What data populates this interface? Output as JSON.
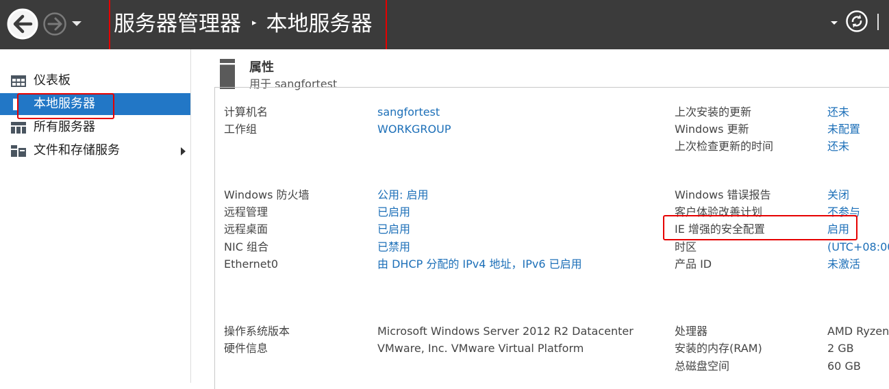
{
  "window": {
    "breadcrumb": {
      "root": "服务器管理器",
      "separator": "▸",
      "current": "本地服务器"
    }
  },
  "sidebar": {
    "items": [
      {
        "label": "仪表板",
        "icon": "dashboard-icon",
        "selected": false
      },
      {
        "label": "本地服务器",
        "icon": "local-server-icon",
        "selected": true
      },
      {
        "label": "所有服务器",
        "icon": "all-servers-icon",
        "selected": false
      },
      {
        "label": "文件和存储服务",
        "icon": "file-storage-icon",
        "selected": false,
        "has_submenu": true
      }
    ]
  },
  "properties": {
    "title": "属性",
    "subtitle": "用于 sangfortest",
    "left": [
      {
        "label": "计算机名",
        "value": "sangfortest",
        "link": true
      },
      {
        "label": "工作组",
        "value": "WORKGROUP",
        "link": true
      },
      {
        "label": "Windows 防火墙",
        "value": "公用: 启用",
        "link": true
      },
      {
        "label": "远程管理",
        "value": "已启用",
        "link": true
      },
      {
        "label": "远程桌面",
        "value": "已启用",
        "link": true
      },
      {
        "label": "NIC 组合",
        "value": "已禁用",
        "link": true
      },
      {
        "label": "Ethernet0",
        "value": "由 DHCP 分配的 IPv4 地址，IPv6 已启用",
        "link": true
      },
      {
        "label": "操作系统版本",
        "value": "Microsoft Windows Server 2012 R2 Datacenter",
        "link": false
      },
      {
        "label": "硬件信息",
        "value": "VMware, Inc. VMware Virtual Platform",
        "link": false
      }
    ],
    "right": [
      {
        "label": "上次安装的更新",
        "value": "还未",
        "link": true
      },
      {
        "label": "Windows 更新",
        "value": "未配置",
        "link": true
      },
      {
        "label": "上次检查更新的时间",
        "value": "还未",
        "link": true
      },
      {
        "label": "Windows 错误报告",
        "value": "关闭",
        "link": true
      },
      {
        "label": "客户体验改善计划",
        "value": "不参与",
        "link": true
      },
      {
        "label": "IE 增强的安全配置",
        "value": "启用",
        "link": true
      },
      {
        "label": "时区",
        "value": "(UTC+08:00",
        "link": true
      },
      {
        "label": "产品 ID",
        "value": "未激活",
        "link": true
      },
      {
        "label": "处理器",
        "value": "AMD Ryzen",
        "link": false
      },
      {
        "label": "安装的内存(RAM)",
        "value": "2 GB",
        "link": false
      },
      {
        "label": "总磁盘空间",
        "value": "60 GB",
        "link": false
      }
    ]
  },
  "colors": {
    "topbar": "#3b3b3b",
    "selected": "#2277c6",
    "link": "#1c6fb8",
    "annotation": "#e60000"
  }
}
